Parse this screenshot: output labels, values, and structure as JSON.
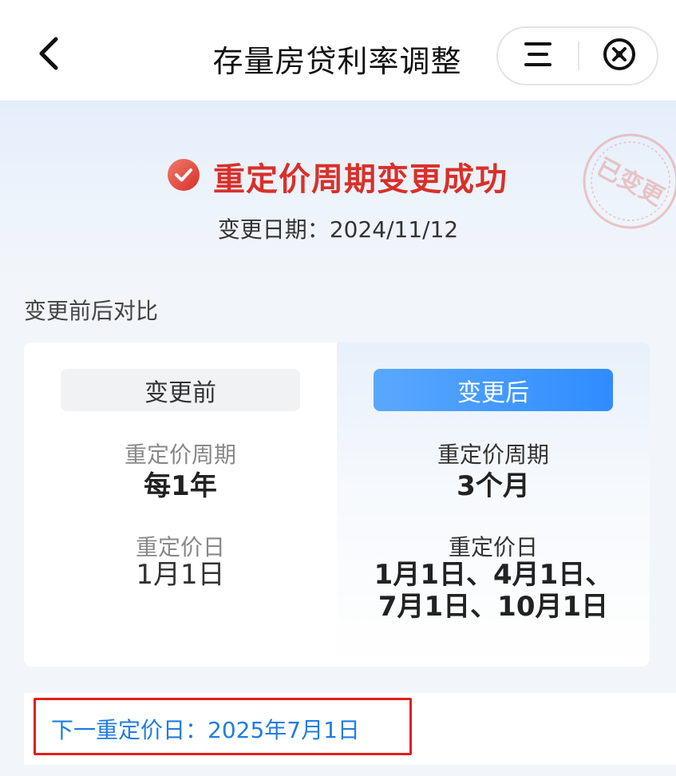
{
  "header": {
    "title": "存量房贷利率调整",
    "back_icon": "chevron-left-icon",
    "menu_icon": "menu-icon",
    "close_icon": "close-circle-icon"
  },
  "status": {
    "title": "重定价周期变更成功",
    "icon": "check-circle-icon",
    "color": "#d8302a",
    "date_label": "变更日期：",
    "date_value": "2024/11/12",
    "stamp_text": "已变更"
  },
  "comparison": {
    "heading": "变更前后对比",
    "before": {
      "tag": "变更前",
      "period_label": "重定价周期",
      "period_value": "每1年",
      "day_label": "重定价日",
      "day_value": "1月1日"
    },
    "after": {
      "tag": "变更后",
      "period_label": "重定价周期",
      "period_value": "3个月",
      "day_label": "重定价日",
      "day_value_line1": "1月1日、4月1日、",
      "day_value_line2": "7月1日、10月1日"
    }
  },
  "next": {
    "text": "下一重定价日：2025年7月1日",
    "color": "#1f7de0"
  }
}
